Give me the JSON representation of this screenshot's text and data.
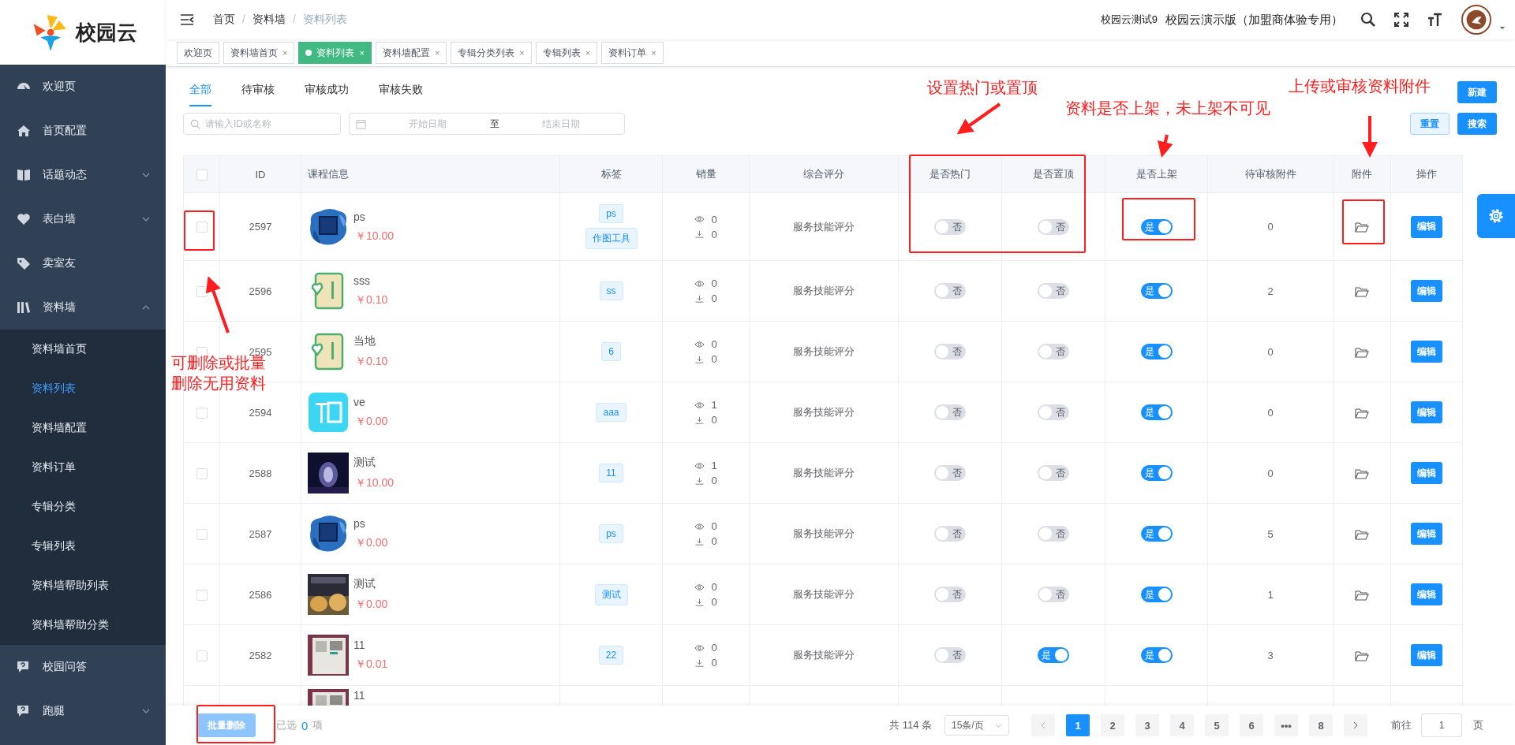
{
  "logo": {
    "text": "校园云"
  },
  "sidebar": {
    "items": [
      {
        "label": "欢迎页",
        "kind": "link"
      },
      {
        "label": "首页配置",
        "kind": "link"
      },
      {
        "label": "话题动态",
        "kind": "group",
        "expanded": false
      },
      {
        "label": "表白墙",
        "kind": "group",
        "expanded": false
      },
      {
        "label": "卖室友",
        "kind": "link"
      },
      {
        "label": "资料墙",
        "kind": "group",
        "expanded": true,
        "children": [
          {
            "label": "资料墙首页",
            "selected": false
          },
          {
            "label": "资料列表",
            "selected": true
          },
          {
            "label": "资料墙配置",
            "selected": false
          },
          {
            "label": "资料订单",
            "selected": false
          },
          {
            "label": "专辑分类",
            "selected": false
          },
          {
            "label": "专辑列表",
            "selected": false
          },
          {
            "label": "资料墙帮助列表",
            "selected": false
          },
          {
            "label": "资料墙帮助分类",
            "selected": false
          }
        ]
      },
      {
        "label": "校园问答",
        "kind": "link"
      },
      {
        "label": "跑腿",
        "kind": "group",
        "expanded": false
      }
    ]
  },
  "breadcrumb": [
    {
      "label": "首页"
    },
    {
      "label": "/",
      "kind": "sep"
    },
    {
      "label": "资料墙"
    },
    {
      "label": "/",
      "kind": "sep"
    },
    {
      "label": "资料列表",
      "current": true
    }
  ],
  "user": {
    "account": "校园云测试9",
    "org": "校园云演示版（加盟商体验专用）"
  },
  "page_tabs": [
    {
      "label": "欢迎页",
      "selected": false,
      "closable": false
    },
    {
      "label": "资料墙首页",
      "selected": false,
      "closable": true,
      "close": "×"
    },
    {
      "label": "资料列表",
      "selected": true,
      "closable": true,
      "close": "×"
    },
    {
      "label": "资料墙配置",
      "selected": false,
      "closable": true,
      "close": "×"
    },
    {
      "label": "专辑分类列表",
      "selected": false,
      "closable": true,
      "close": "×"
    },
    {
      "label": "专辑列表",
      "selected": false,
      "closable": true,
      "close": "×"
    },
    {
      "label": "资料订单",
      "selected": false,
      "closable": true,
      "close": "×"
    }
  ],
  "status_tabs": [
    {
      "label": "全部",
      "selected": true
    },
    {
      "label": "待审核",
      "selected": false
    },
    {
      "label": "审核成功",
      "selected": false
    },
    {
      "label": "审核失败",
      "selected": false
    }
  ],
  "search": {
    "placeholder": "请输入ID或名称"
  },
  "date_range": {
    "start_placeholder": "开始日期",
    "separator": "至",
    "end_placeholder": "结束日期"
  },
  "buttons": {
    "new": "新建",
    "reset": "重置",
    "search": "搜索"
  },
  "table": {
    "select_all": {
      "checked": false
    },
    "columns": [
      "ID",
      "课程信息",
      "标签",
      "销量",
      "综合评分",
      "是否热门",
      "是否置顶",
      "是否上架",
      "待审核附件",
      "附件",
      "操作"
    ],
    "rows": [
      {
        "checked": false,
        "id": "2597",
        "name": "ps",
        "price": "￥10.00",
        "tags": [
          "ps",
          "作图工具"
        ],
        "views": "0",
        "downloads": "0",
        "rating": "服务技能评分",
        "hot": {
          "on": false,
          "label": "否"
        },
        "top": {
          "on": false,
          "label": "否"
        },
        "listed": {
          "on": true,
          "label": "是"
        },
        "pending": "0",
        "action": "编辑"
      },
      {
        "checked": false,
        "id": "2596",
        "name": "sss",
        "price": "￥0.10",
        "tags": [
          "ss"
        ],
        "views": "0",
        "downloads": "0",
        "rating": "服务技能评分",
        "hot": {
          "on": false,
          "label": "否"
        },
        "top": {
          "on": false,
          "label": "否"
        },
        "listed": {
          "on": true,
          "label": "是"
        },
        "pending": "2",
        "action": "编辑"
      },
      {
        "checked": false,
        "id": "2595",
        "name": "当地",
        "price": "￥0.10",
        "tags": [
          "6"
        ],
        "views": "0",
        "downloads": "0",
        "rating": "服务技能评分",
        "hot": {
          "on": false,
          "label": "否"
        },
        "top": {
          "on": false,
          "label": "否"
        },
        "listed": {
          "on": true,
          "label": "是"
        },
        "pending": "0",
        "action": "编辑"
      },
      {
        "checked": false,
        "id": "2594",
        "name": "ve",
        "price": "￥0.00",
        "tags": [
          "aaa"
        ],
        "views": "1",
        "downloads": "0",
        "rating": "服务技能评分",
        "hot": {
          "on": false,
          "label": "否"
        },
        "top": {
          "on": false,
          "label": "否"
        },
        "listed": {
          "on": true,
          "label": "是"
        },
        "pending": "0",
        "action": "编辑"
      },
      {
        "checked": false,
        "id": "2588",
        "name": "测试",
        "price": "￥10.00",
        "tags": [
          "11"
        ],
        "views": "1",
        "downloads": "0",
        "rating": "服务技能评分",
        "hot": {
          "on": false,
          "label": "否"
        },
        "top": {
          "on": false,
          "label": "否"
        },
        "listed": {
          "on": true,
          "label": "是"
        },
        "pending": "0",
        "action": "编辑"
      },
      {
        "checked": false,
        "id": "2587",
        "name": "ps",
        "price": "￥0.00",
        "tags": [
          "ps"
        ],
        "views": "0",
        "downloads": "0",
        "rating": "服务技能评分",
        "hot": {
          "on": false,
          "label": "否"
        },
        "top": {
          "on": false,
          "label": "否"
        },
        "listed": {
          "on": true,
          "label": "是"
        },
        "pending": "5",
        "action": "编辑"
      },
      {
        "checked": false,
        "id": "2586",
        "name": "测试",
        "price": "￥0.00",
        "tags": [
          "测试"
        ],
        "views": "0",
        "downloads": "0",
        "rating": "服务技能评分",
        "hot": {
          "on": false,
          "label": "否"
        },
        "top": {
          "on": false,
          "label": "否"
        },
        "listed": {
          "on": true,
          "label": "是"
        },
        "pending": "1",
        "action": "编辑"
      },
      {
        "checked": false,
        "id": "2582",
        "name": "11",
        "price": "￥0.01",
        "tags": [
          "22"
        ],
        "views": "0",
        "downloads": "0",
        "rating": "服务技能评分",
        "hot": {
          "on": false,
          "label": "否"
        },
        "top": {
          "on": true,
          "label": "是"
        },
        "listed": {
          "on": true,
          "label": "是"
        },
        "pending": "3",
        "action": "编辑"
      },
      {
        "name": "11"
      }
    ]
  },
  "footer": {
    "batch_delete": "批量删除",
    "selected_label": "已选",
    "selected_count": "0",
    "selected_unit": "项",
    "total": "共 114 条",
    "page_size": "15条/页",
    "pages": [
      {
        "label": "1",
        "selected": true
      },
      {
        "label": "2",
        "selected": false
      },
      {
        "label": "3",
        "selected": false
      },
      {
        "label": "4",
        "selected": false
      },
      {
        "label": "5",
        "selected": false
      },
      {
        "label": "6",
        "selected": false
      },
      {
        "label": "•••",
        "selected": false
      },
      {
        "label": "8",
        "selected": false
      }
    ],
    "goto_label": "前往",
    "goto_value": "1",
    "goto_unit": "页"
  },
  "annotations": [
    {
      "text": "设置热门或置顶"
    },
    {
      "text": "资料是否上架，未上架不可见"
    },
    {
      "text": "上传或审核资料附件"
    },
    {
      "text": "可删除或批量删除无用资料"
    }
  ]
}
